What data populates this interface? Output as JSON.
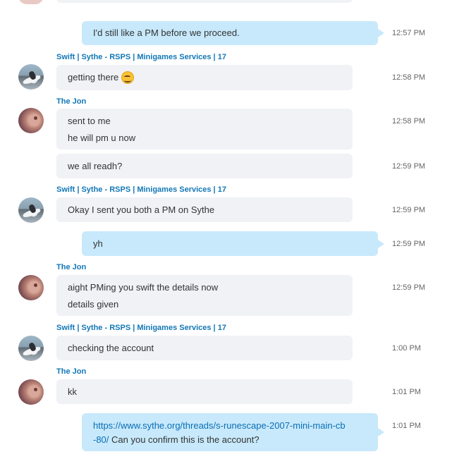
{
  "participants": {
    "swift": "Swift | Sythe - RSPS | Minigames Services | 17",
    "jon": "The Jon"
  },
  "messages": [
    {
      "id": "m1",
      "side": "out",
      "lines": [
        "I'd still like a PM before we proceed."
      ],
      "time": "12:57 PM"
    },
    {
      "id": "m2",
      "side": "in",
      "sender": "Swift | Sythe - RSPS | Minigames Services | 17",
      "lines": [
        "getting there"
      ],
      "emoji": "smiling-face-icon",
      "time": "12:58 PM"
    },
    {
      "id": "m3",
      "side": "in",
      "sender": "The Jon",
      "lines": [
        "sent to me",
        "he will pm u now"
      ],
      "time": "12:58 PM"
    },
    {
      "id": "m4",
      "side": "in",
      "lines": [
        "we all readh?"
      ],
      "time": "12:59 PM"
    },
    {
      "id": "m5",
      "side": "in",
      "sender": "Swift | Sythe - RSPS | Minigames Services | 17",
      "lines": [
        "Okay I sent you both a PM on Sythe"
      ],
      "time": "12:59 PM"
    },
    {
      "id": "m6",
      "side": "out",
      "lines": [
        "yh"
      ],
      "time": "12:59 PM"
    },
    {
      "id": "m7",
      "side": "in",
      "sender": "The Jon",
      "lines": [
        "aight PMing you swift the details now",
        "details given"
      ],
      "time": "12:59 PM"
    },
    {
      "id": "m8",
      "side": "in",
      "sender": "Swift | Sythe - RSPS | Minigames Services | 17",
      "lines": [
        "checking the account"
      ],
      "time": "1:00 PM"
    },
    {
      "id": "m9",
      "side": "in",
      "sender": "The Jon",
      "lines": [
        "kk"
      ],
      "time": "1:01 PM"
    },
    {
      "id": "m10",
      "side": "out",
      "link_line1": "https://www.sythe.org/threads/s-runescape-2007-mini-main-cb",
      "link_line2": "-80/",
      "text_after_link": " Can you confirm this is the account?",
      "time": "1:01 PM"
    }
  ],
  "colors": {
    "incoming_bubble": "#f1f2f6",
    "outgoing_bubble": "#c7e9fb",
    "sender_name": "#1377b6",
    "link": "#0b6eb5"
  }
}
